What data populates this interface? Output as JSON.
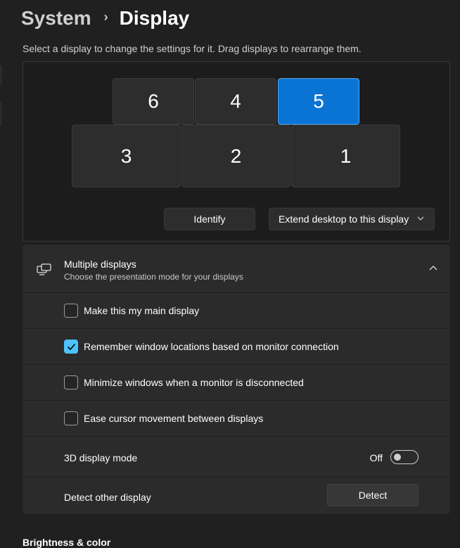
{
  "breadcrumb": {
    "parent": "System",
    "separator": "›",
    "current": "Display"
  },
  "hint": "Select a display to change the settings for it. Drag displays to rearrange them.",
  "monitors": [
    {
      "label": "6",
      "selected": false
    },
    {
      "label": "4",
      "selected": false
    },
    {
      "label": "5",
      "selected": true
    },
    {
      "label": "3",
      "selected": false
    },
    {
      "label": "2",
      "selected": false
    },
    {
      "label": "1",
      "selected": false
    }
  ],
  "identify_button": "Identify",
  "extend_select": {
    "value": "Extend desktop to this display"
  },
  "multiple_displays": {
    "title": "Multiple displays",
    "subtitle": "Choose the presentation mode for your displays",
    "expanded": true,
    "options": [
      {
        "label": "Make this my main display",
        "checked": false
      },
      {
        "label": "Remember window locations based on monitor connection",
        "checked": true
      },
      {
        "label": "Minimize windows when a monitor is disconnected",
        "checked": false
      },
      {
        "label": "Ease cursor movement between displays",
        "checked": false
      }
    ],
    "three_d": {
      "label": "3D display mode",
      "state": "Off",
      "on": false
    },
    "detect": {
      "label": "Detect other display",
      "button": "Detect"
    }
  },
  "next_section_heading": "Brightness & color",
  "colors": {
    "accent": "#0a74d4",
    "checkbox_accent": "#4cc2ff",
    "background": "#202020"
  }
}
